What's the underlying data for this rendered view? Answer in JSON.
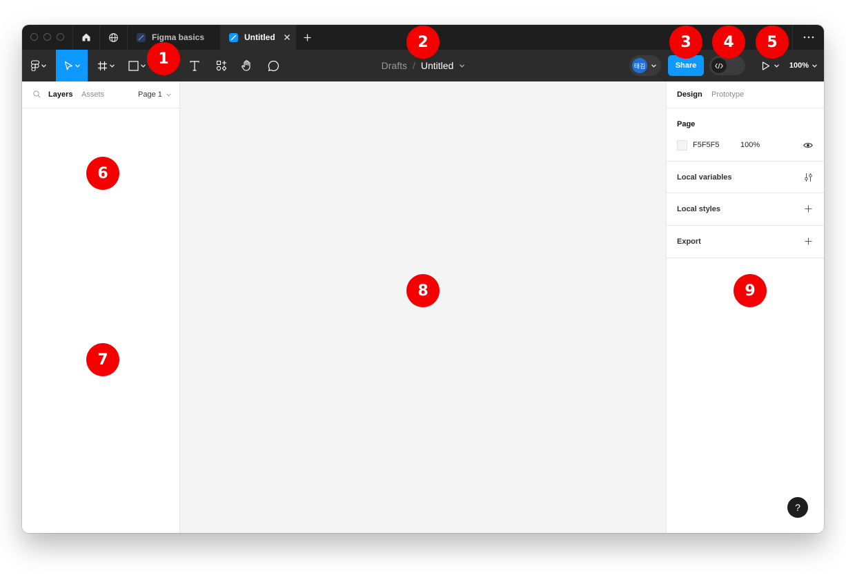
{
  "tabs": [
    {
      "label": "Figma basics"
    },
    {
      "label": "Untitled"
    }
  ],
  "toolbar": {
    "breadcrumb_parent": "Drafts",
    "breadcrumb_separator": "/",
    "file_name": "Untitled",
    "avatar_text": "태김",
    "share_label": "Share",
    "zoom_label": "100%"
  },
  "layers_panel": {
    "tab_layers": "Layers",
    "tab_assets": "Assets",
    "page_selector": "Page 1"
  },
  "design_panel": {
    "tab_design": "Design",
    "tab_prototype": "Prototype",
    "page_section_title": "Page",
    "page_color_hex": "F5F5F5",
    "page_opacity": "100%",
    "local_variables": "Local variables",
    "local_styles": "Local styles",
    "export": "Export"
  },
  "help_label": "?",
  "annotations": [
    "1",
    "2",
    "3",
    "4",
    "5",
    "6",
    "7",
    "8",
    "9"
  ],
  "colors": {
    "accent": "#0d99ff",
    "annotation_red": "#f50000",
    "toolbar_bg": "#2c2c2c",
    "tabbar_bg": "#1e1e1e",
    "canvas_bg": "#f3f3f3",
    "page_swatch": "#F5F5F5"
  }
}
